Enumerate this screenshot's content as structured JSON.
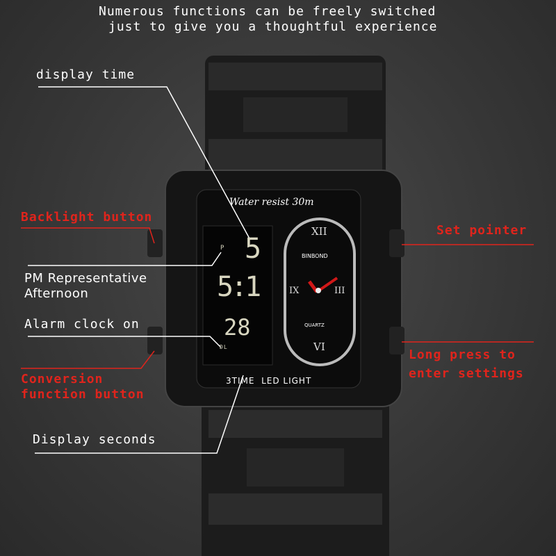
{
  "heading": {
    "line1": "Numerous functions can be freely switched",
    "line2": "just to give you a thoughtful experience"
  },
  "callouts": {
    "display_time": "display time",
    "backlight": "Backlight button",
    "pm_line1": "PM Representative",
    "pm_line2": "Afternoon",
    "alarm": "Alarm clock on",
    "conversion_line1": "Conversion",
    "conversion_line2": "function button",
    "seconds": "Display seconds",
    "set_pointer": "Set pointer",
    "long_press_line1": "Long press to",
    "long_press_line2": "enter settings"
  },
  "watch": {
    "bezel_top": "Water resist 30m",
    "bezel_bottom": "3TIME  LED LIGHT",
    "brand": "BINBOND",
    "movement": "QUARTZ",
    "numerals": {
      "top": "XII",
      "left": "IX",
      "right": "III",
      "bottom": "VI"
    },
    "lcd": {
      "pm": "P",
      "hour_top": "5",
      "time": "5:1",
      "seconds": "28",
      "alarm": "DL"
    }
  },
  "colors": {
    "accent_red": "#e0241c",
    "hand_red": "#d01818",
    "background": "#3a3a3a"
  }
}
